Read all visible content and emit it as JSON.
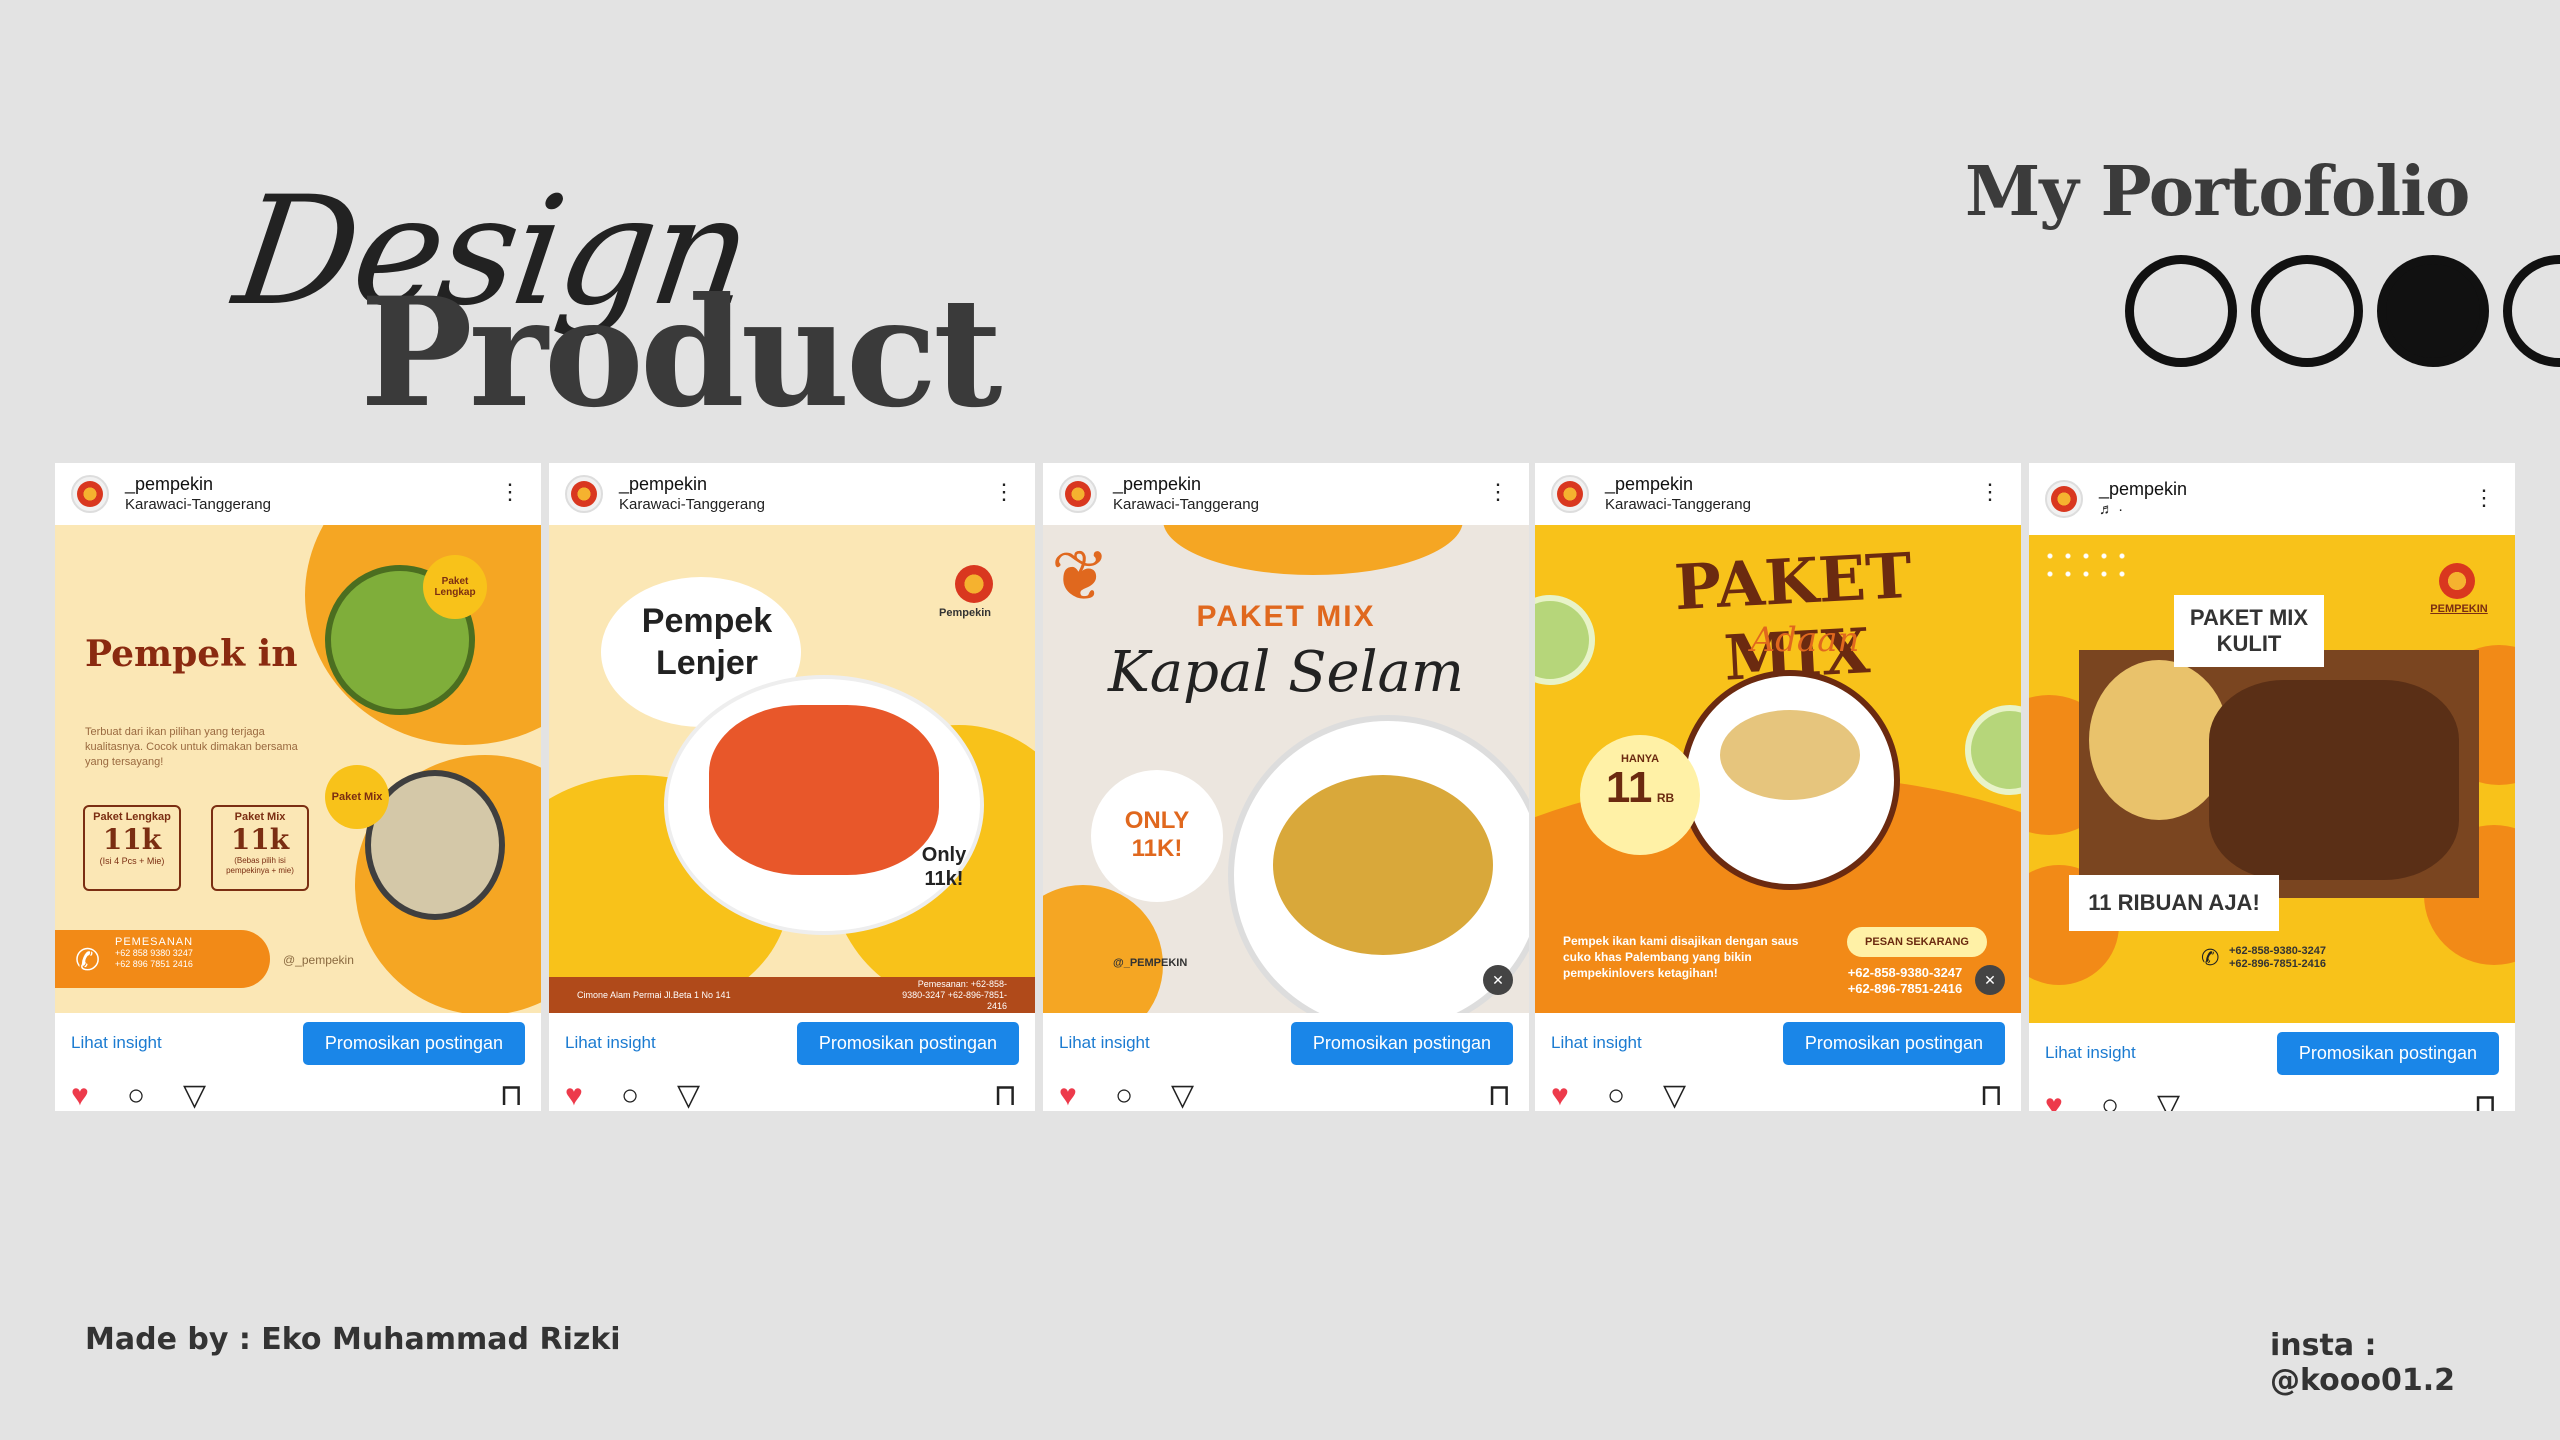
{
  "header": {
    "script_word": "Design",
    "main_word": "Product",
    "portfolio": "My Portofolio"
  },
  "footer": {
    "made_by": "Made by : Eko Muhammad Rizki",
    "insta": "insta : @kooo01.2"
  },
  "common": {
    "insight": "Lihat insight",
    "promote": "Promosikan postingan"
  },
  "posts": [
    {
      "username": "_pempekin",
      "location": "Karawaci-Tanggerang",
      "art": {
        "headline": "Pempek in",
        "tagline": "Terbuat dari ikan pilihan yang terjaga kualitasnya. Cocok untuk dimakan bersama yang tersayang!",
        "badge1": "Paket Lengkap",
        "badge2": "Paket Mix",
        "box1_title": "Paket Lengkap",
        "box1_price": "11k",
        "box1_note": "(Isi 4 Pcs + Mie)",
        "box2_title": "Paket Mix",
        "box2_price": "11k",
        "box2_note": "(Bebas pilih isi pempekinya + mie)",
        "order": "PEMESANAN",
        "phones": "+62 858 9380 3247\n+62 896 7851 2416",
        "social": "@_pempekin"
      }
    },
    {
      "username": "_pempekin",
      "location": "Karawaci-Tanggerang",
      "art": {
        "headline": "Pempek Lenjer",
        "brand": "Pempekin",
        "price": "Only 11k!",
        "address": "Cimone Alam Permai Jl.Beta 1 No 141",
        "order": "Pemesanan: +62-858-9380-3247 +62-896-7851-2416"
      }
    },
    {
      "username": "_pempekin",
      "location": "Karawaci-Tanggerang",
      "art": {
        "headline_top": "PAKET MIX",
        "headline": "Kapal Selam",
        "price": "ONLY 11K!",
        "social": "@_PEMPEKIN"
      }
    },
    {
      "username": "_pempekin",
      "location": "Karawaci-Tanggerang",
      "art": {
        "headline": "PAKET MIX",
        "sub": "Adaan",
        "hanya": "HANYA",
        "price": "11",
        "unit": "RB",
        "desc": "Pempek ikan kami disajikan dengan saus cuko khas Palembang yang bikin pempekinlovers ketagihan!",
        "cta": "PESAN SEKARANG",
        "phones": "+62-858-9380-3247 +62-896-7851-2416"
      }
    },
    {
      "username": "_pempekin",
      "location": "♬ ·",
      "art": {
        "brand": "PEMPEKIN",
        "headline": "PAKET MIX KULIT",
        "price": "11 RIBUAN AJA!",
        "phones": "+62-858-9380-3247 +62-896-7851-2416"
      }
    }
  ],
  "colors": {
    "background": "#e3e3e3",
    "accent_blue": "#1a86e8",
    "yellow": "#f8c21a",
    "orange": "#f28a17",
    "heart": "#ed3a4b"
  }
}
